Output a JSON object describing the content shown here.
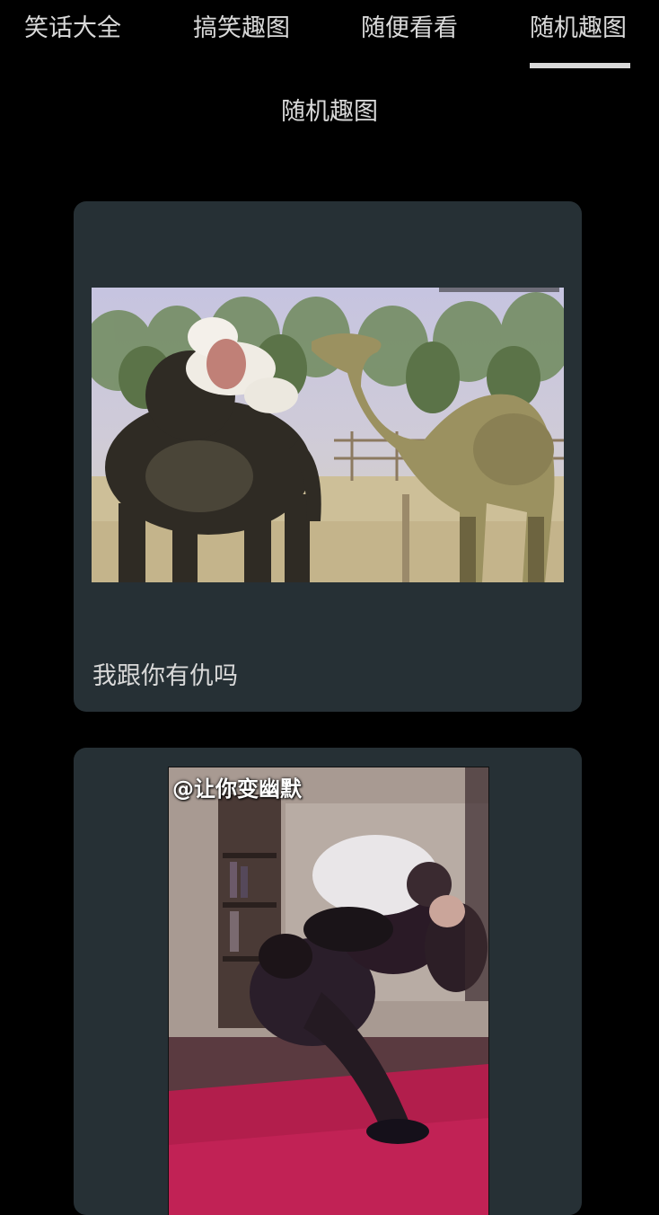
{
  "tabs": [
    {
      "label": "笑话大全",
      "active": false
    },
    {
      "label": "搞笑趣图",
      "active": false
    },
    {
      "label": "随便看看",
      "active": false
    },
    {
      "label": "随机趣图",
      "active": true
    }
  ],
  "page_title": "随机趣图",
  "posts": [
    {
      "caption": "我跟你有仇吗",
      "image": "camels-gif"
    },
    {
      "caption": "",
      "image": "people-wrestling-gif",
      "watermark": "@让你变幽默"
    }
  ]
}
